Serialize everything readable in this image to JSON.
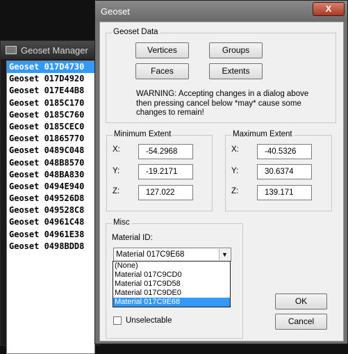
{
  "geoset_manager": {
    "title": "Geoset Manager",
    "items": [
      "Geoset 017D4730",
      "Geoset 017D4920",
      "Geoset 017E44B8",
      "Geoset 0185C170",
      "Geoset 0185C760",
      "Geoset 0185CEC0",
      "Geoset 01865770",
      "Geoset 0489C048",
      "Geoset 048B8570",
      "Geoset 048BA830",
      "Geoset 0494E940",
      "Geoset 049526D8",
      "Geoset 049528C8",
      "Geoset 04961C48",
      "Geoset 04961E38",
      "Geoset 0498BDD8"
    ],
    "selected_index": 0
  },
  "dialog": {
    "title": "Geoset",
    "close_label": "X",
    "geoset_data": {
      "label": "Geoset Data",
      "vertices_label": "Vertices",
      "groups_label": "Groups",
      "faces_label": "Faces",
      "extents_label": "Extents",
      "warning_lines": [
        "WARNING: Accepting changes in a dialog above",
        "then pressing cancel below *may* cause some",
        "changes to remain!"
      ]
    },
    "minimum_extent": {
      "label": "Minimum Extent",
      "x_label": "X:",
      "x_value": "-54.2968",
      "y_label": "Y:",
      "y_value": "-19.2171",
      "z_label": "Z:",
      "z_value": "127.022"
    },
    "maximum_extent": {
      "label": "Maximum Extent",
      "x_label": "X:",
      "x_value": "-40.5326",
      "y_label": "Y:",
      "y_value": "30.6374",
      "z_label": "Z:",
      "z_value": "139.171"
    },
    "misc": {
      "label": "Misc",
      "material_id_label": "Material ID:",
      "material_selected": "Material 017C9E68",
      "material_options": [
        "(None)",
        "Material 017C9CD0",
        "Material 017C9D58",
        "Material 017C9DE0",
        "Material 017C9E68"
      ],
      "highlighted_option_index": 4,
      "unselectable_label": "Unselectable",
      "unselectable_checked": false
    },
    "ok_label": "OK",
    "cancel_label": "Cancel"
  }
}
